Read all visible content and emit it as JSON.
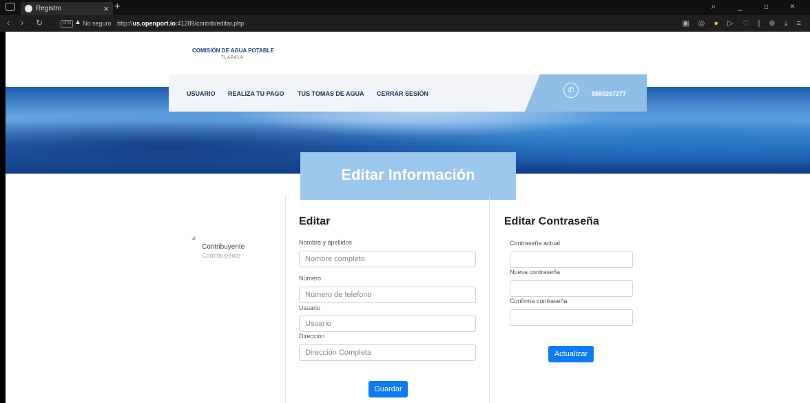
{
  "browser": {
    "tab_title": "Registro",
    "security_label": "No seguro",
    "url_prefix": "http://",
    "url_host": "us.openport.io",
    "url_path": ":41289/contrib/editar.php"
  },
  "header": {
    "logo_title": "COMISIÓN DE AGUA POTABLE",
    "logo_subtitle": "TLAPALA",
    "nav": [
      "USUARIO",
      "REALIZA TU PAGO",
      "TUS TOMAS DE AGUA",
      "CERRAR SESIÓN"
    ],
    "phone": "5590267277"
  },
  "page_title": "Editar Información",
  "profile": {
    "name": "Contribuyente",
    "role": "Contribuyente"
  },
  "edit_form": {
    "heading": "Editar",
    "fields": [
      {
        "label": "Nombre y apellidos",
        "placeholder": "Nombre completo"
      },
      {
        "label": "Número",
        "placeholder": "Número de telefono"
      },
      {
        "label": "Usuario",
        "placeholder": "Usuario"
      },
      {
        "label": "Dirección",
        "placeholder": "Dirección Completa"
      }
    ],
    "submit": "Guardar"
  },
  "password_form": {
    "heading": "Editar Contraseña",
    "fields": [
      {
        "label": "Contraseña actual",
        "placeholder": ""
      },
      {
        "label": "Nueva contraseña",
        "placeholder": ""
      },
      {
        "label": "Confirma contraseña",
        "placeholder": ""
      }
    ],
    "submit": "Actualizar"
  },
  "colors": {
    "primary_button": "#0d7bf5",
    "title_box": "#9cc7ec",
    "nav_text": "#1c2f55"
  }
}
